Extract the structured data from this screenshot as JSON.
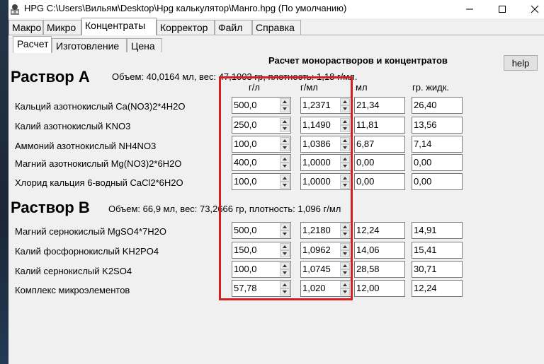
{
  "window": {
    "title": "HPG C:\\Users\\Вильям\\Desktop\\Hpg калькулятор\\Манго.hpg (По умолчанию)"
  },
  "menu_tabs": [
    "Макро",
    "Микро",
    "Концентраты",
    "Корректор",
    "Файл",
    "Справка"
  ],
  "active_menu_tab": "Концентраты",
  "sub_tabs": [
    "Расчет",
    "Изготовление",
    "Цена"
  ],
  "active_sub_tab": "Расчет",
  "calc_title": "Расчет монорастворов и концентратов",
  "help_label": "help",
  "columns": [
    "г/л",
    "г/мл",
    "мл",
    "гр. жидк."
  ],
  "solution_a": {
    "title": "Раствор А",
    "info": "Объем: 40,0164 мл, вес: 47,1003 гр, плотность: 1,18 г/мл.",
    "rows": [
      {
        "label": "Кальций азотнокислый Ca(NO3)2*4H2O",
        "gl": "500,0",
        "gml": "1,2371",
        "ml": "21,34",
        "gr": "26,40"
      },
      {
        "label": "Калий азотнокислый KNO3",
        "gl": "250,0",
        "gml": "1,1490",
        "ml": "11,81",
        "gr": "13,56"
      },
      {
        "label": "Аммоний азотнокислый NH4NO3",
        "gl": "100,0",
        "gml": "1,0386",
        "ml": "6,87",
        "gr": "7,14"
      },
      {
        "label": "Магний азотнокислый Mg(NO3)2*6H2O",
        "gl": "400,0",
        "gml": "1,0000",
        "ml": "0,00",
        "gr": "0,00"
      },
      {
        "label": "Хлорид кальция 6-водный CaCl2*6H2O",
        "gl": "100,0",
        "gml": "1,0000",
        "ml": "0,00",
        "gr": "0,00"
      }
    ]
  },
  "solution_b": {
    "title": "Раствор В",
    "info": "Объем: 66,9 мл, вес: 73,2666 гр, плотность: 1,096 г/мл",
    "rows": [
      {
        "label": "Магний сернокислый MgSO4*7H2O",
        "gl": "500,0",
        "gml": "1,2180",
        "ml": "12,24",
        "gr": "14,91"
      },
      {
        "label": "Калий фосфорнокислый KH2PO4",
        "gl": "150,0",
        "gml": "1,0962",
        "ml": "14,06",
        "gr": "15,41"
      },
      {
        "label": "Калий сернокислый K2SO4",
        "gl": "100,0",
        "gml": "1,0745",
        "ml": "28,58",
        "gr": "30,71"
      },
      {
        "label": "Комплекс микроэлементов",
        "gl": "57,78",
        "gml": "1,020",
        "ml": "12,00",
        "gr": "12,24"
      }
    ]
  },
  "highlight_color": "#d21f1f"
}
